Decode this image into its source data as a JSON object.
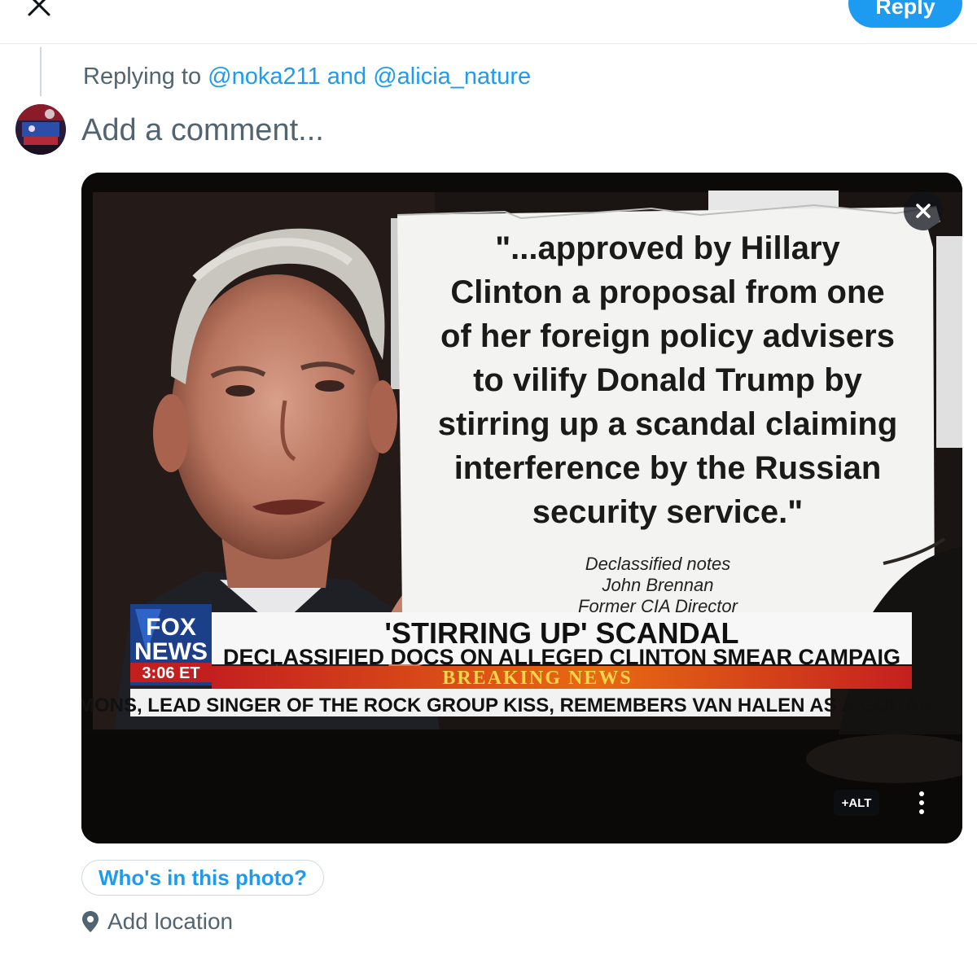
{
  "header": {
    "close_icon": "close-x-icon",
    "reply_label": "Reply",
    "accent_color": "#1d9bf0"
  },
  "replying": {
    "prefix": "Replying to",
    "mention_1": "@noka211",
    "conjunction": "and",
    "mention_2": "@alicia_nature"
  },
  "compose": {
    "placeholder": "Add a comment..."
  },
  "media": {
    "remove_icon": "close-x-icon",
    "alt_label": "+ALT",
    "more_icon": "vertical-ellipsis-icon",
    "quote_lines": [
      "\"...approved by Hillary",
      "Clinton a proposal from one",
      "of her foreign policy advisers",
      "to vilify Donald Trump by",
      "stirring up a scandal claiming",
      "interference by the Russian",
      "security service.\""
    ],
    "attribution": [
      "Declassified notes",
      "John Brennan",
      "Former CIA Director"
    ],
    "network_logo": [
      "FOX",
      "NEWS"
    ],
    "clock": "3:06 ET",
    "headline": "'STIRRING UP' SCANDAL",
    "subheadline": "DECLASSIFIED DOCS ON ALLEGED CLINTON SMEAR CAMPAIG",
    "breaking": "BREAKING NEWS",
    "ticker": "NE SIMMONS, LEAD SINGER OF THE ROCK GROUP KISS, REMEMBERS VAN HALEN AS A GUITAR"
  },
  "tag_people_label": "Who's in this photo?",
  "location": {
    "icon": "location-pin-icon",
    "label": "Add location"
  }
}
